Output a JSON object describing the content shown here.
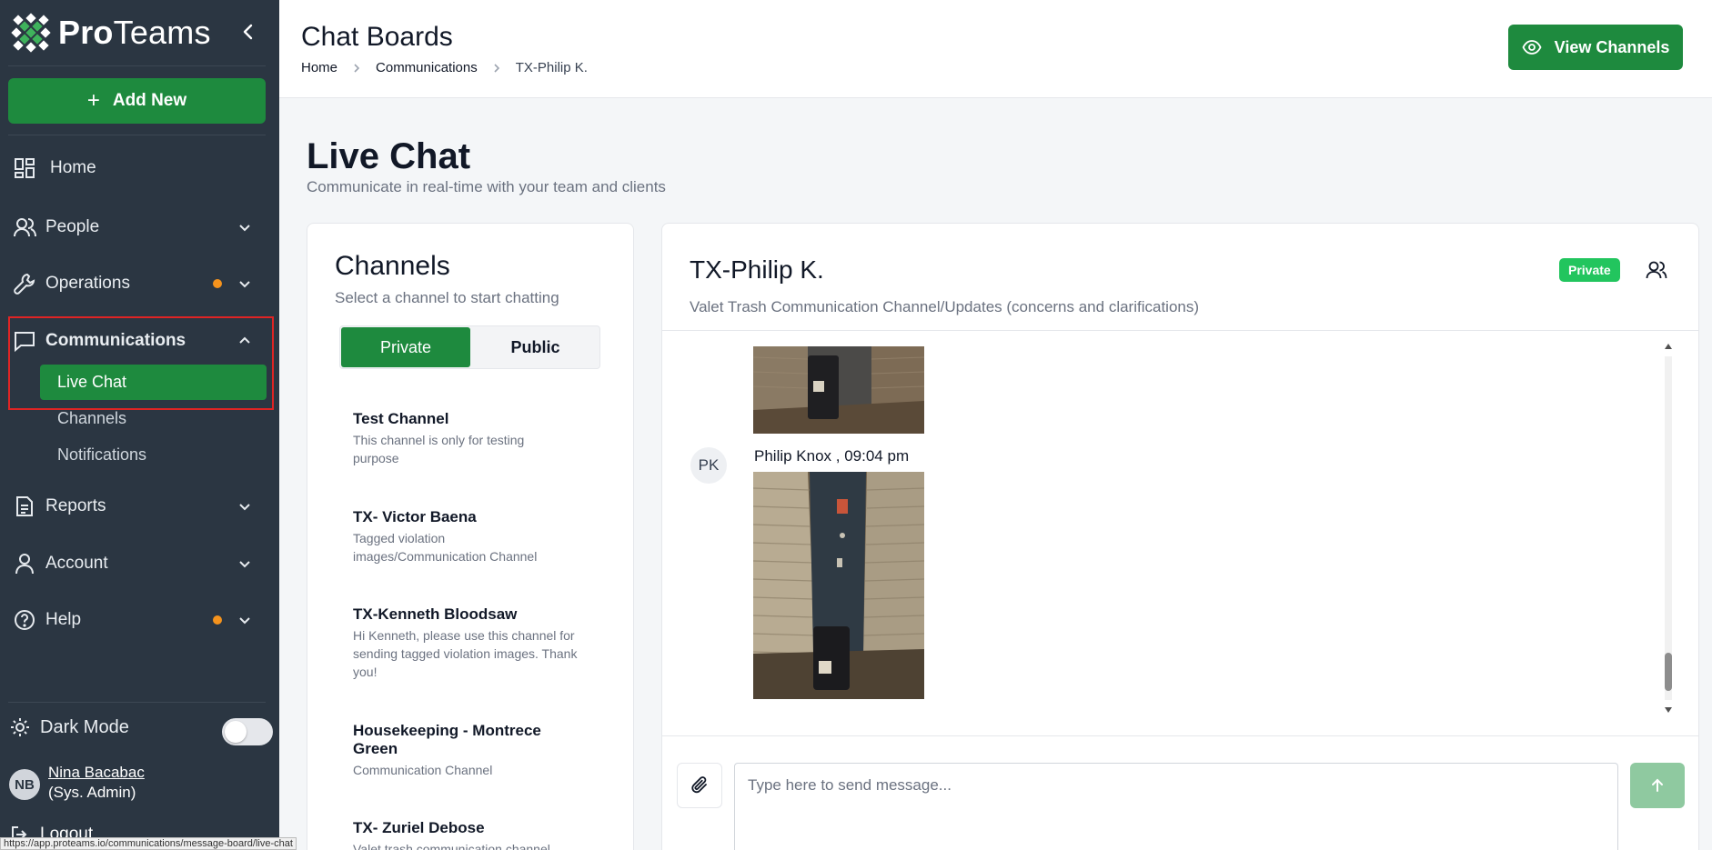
{
  "brand": {
    "name_bold": "Pro",
    "name_light": "Teams"
  },
  "sidebar": {
    "add_new_label": "Add New",
    "items": [
      {
        "label": "Home"
      },
      {
        "label": "People"
      },
      {
        "label": "Operations"
      },
      {
        "label": "Communications"
      },
      {
        "label": "Reports"
      },
      {
        "label": "Account"
      },
      {
        "label": "Help"
      }
    ],
    "communications_sub": [
      "Live Chat",
      "Channels",
      "Notifications"
    ],
    "dark_mode_label": "Dark Mode",
    "dark_mode_on": false,
    "user": {
      "initials": "NB",
      "name": "Nina Bacabac",
      "role": "(Sys. Admin)"
    },
    "logout_label": "Logout",
    "status_url": "https://app.proteams.io/communications/message-board/live-chat"
  },
  "header": {
    "title": "Chat Boards",
    "breadcrumb": [
      "Home",
      "Communications",
      "TX-Philip K."
    ],
    "view_channels_label": "View Channels"
  },
  "main": {
    "title": "Live Chat",
    "subtitle": "Communicate in real-time with your team and clients"
  },
  "channels": {
    "title": "Channels",
    "subtitle": "Select a channel to start chatting",
    "tabs": [
      "Private",
      "Public"
    ],
    "active_tab": "Private",
    "list": [
      {
        "name": "Test Channel",
        "desc": "This channel is only for testing purpose"
      },
      {
        "name": "TX- Victor Baena",
        "desc": "Tagged violation images/Communication Channel"
      },
      {
        "name": "TX-Kenneth Bloodsaw",
        "desc": "Hi Kenneth, please use this channel for sending tagged violation images. Thank you!"
      },
      {
        "name": "Housekeeping - Montrece Green",
        "desc": "Communication Channel"
      },
      {
        "name": "TX- Zuriel Debose",
        "desc": "Valet trash communication channel"
      }
    ]
  },
  "chat": {
    "title": "TX-Philip K.",
    "description": "Valet Trash Communication Channel/Updates (concerns and clarifications)",
    "badge": "Private",
    "message": {
      "initials": "PK",
      "sender_line": "Philip Knox , 09:04 pm"
    },
    "input_placeholder": "Type here to send message..."
  },
  "colors": {
    "sidebar": "#2b3642",
    "accent": "#1e8a3e",
    "badge": "#22c55e",
    "notify_dot": "#f5931d",
    "highlight_border": "#e02424"
  }
}
